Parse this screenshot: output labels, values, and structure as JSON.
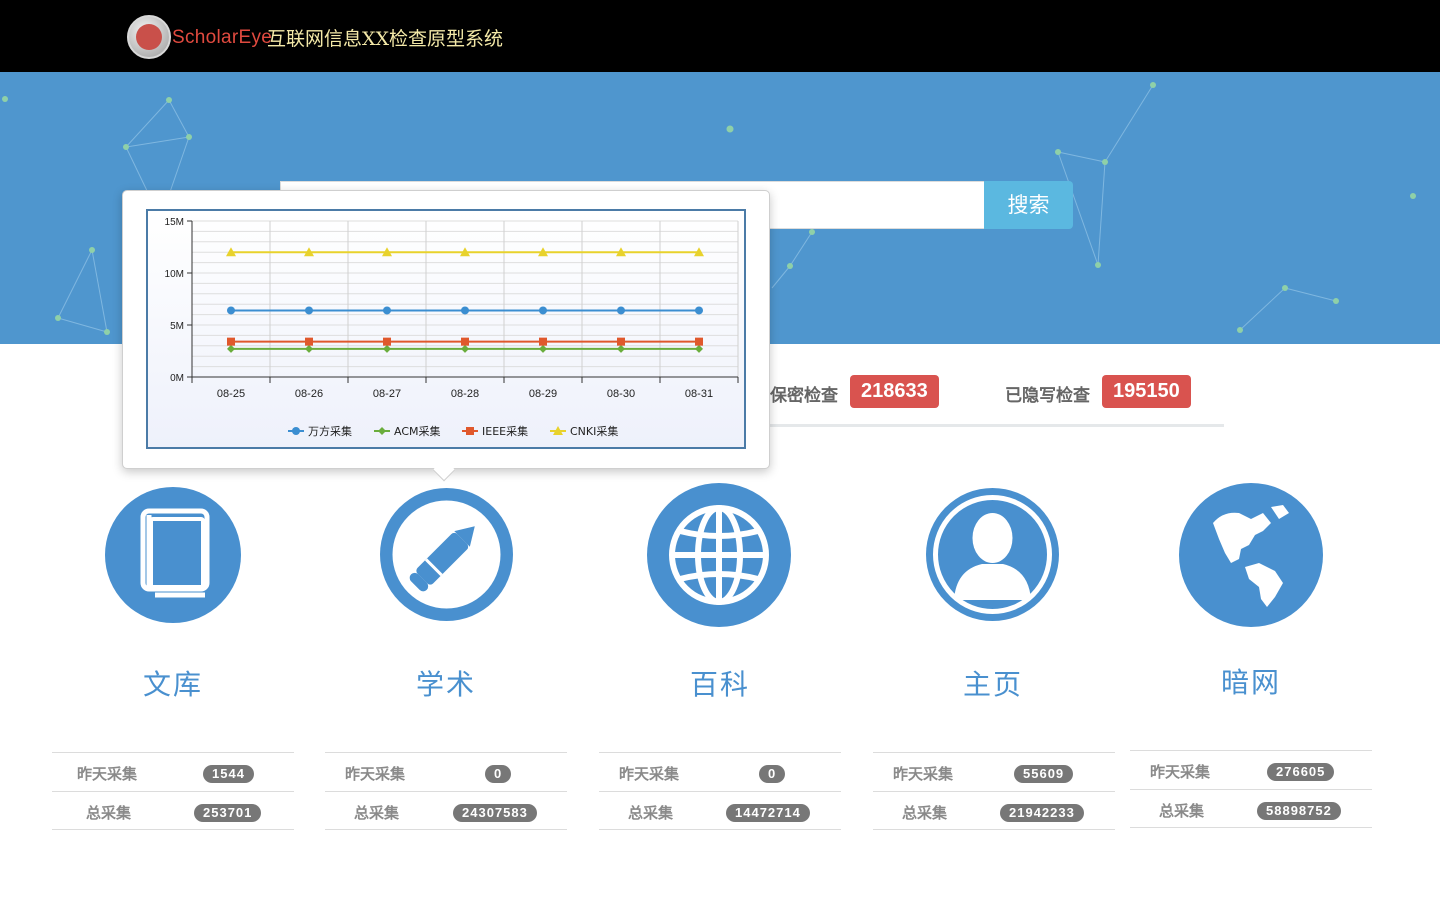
{
  "header": {
    "brand": "ScholarEye",
    "title": "互联网信息XX检查原型系统"
  },
  "search": {
    "placeholder": "",
    "value": "",
    "button": "搜索"
  },
  "stats": [
    {
      "label": "保密检查",
      "value": "218633"
    },
    {
      "label": "已隐写检查",
      "value": "195150"
    }
  ],
  "chart_data": {
    "type": "line",
    "x": [
      "08-25",
      "08-26",
      "08-27",
      "08-28",
      "08-29",
      "08-30",
      "08-31"
    ],
    "ylim": [
      0,
      15000000
    ],
    "yticks": [
      "0M",
      "5M",
      "10M",
      "15M"
    ],
    "ytick_values": [
      0,
      5000000,
      10000000,
      15000000
    ],
    "grid": true,
    "legend": "bottom",
    "series": [
      {
        "name": "万方采集",
        "color": "#3b8ed1",
        "marker": "circle",
        "values": [
          6400000,
          6400000,
          6400000,
          6400000,
          6400000,
          6400000,
          6400000
        ]
      },
      {
        "name": "ACM采集",
        "color": "#6aad3c",
        "marker": "diamond",
        "values": [
          2700000,
          2700000,
          2700000,
          2700000,
          2700000,
          2700000,
          2700000
        ]
      },
      {
        "name": "IEEE采集",
        "color": "#e0582c",
        "marker": "square",
        "values": [
          3400000,
          3400000,
          3400000,
          3400000,
          3400000,
          3400000,
          3400000
        ]
      },
      {
        "name": "CNKI采集",
        "color": "#e8d22c",
        "marker": "triangle",
        "values": [
          12000000,
          12000000,
          12000000,
          12000000,
          12000000,
          12000000,
          12000000
        ]
      }
    ]
  },
  "categories": [
    {
      "title": "文库",
      "icon": "book-icon",
      "yesterday_label": "昨天采集",
      "yesterday": "1544",
      "total_label": "总采集",
      "total": "253701"
    },
    {
      "title": "学术",
      "icon": "pencil-icon",
      "yesterday_label": "昨天采集",
      "yesterday": "0",
      "total_label": "总采集",
      "total": "24307583"
    },
    {
      "title": "百科",
      "icon": "globe-icon",
      "yesterday_label": "昨天采集",
      "yesterday": "0",
      "total_label": "总采集",
      "total": "14472714"
    },
    {
      "title": "主页",
      "icon": "user-icon",
      "yesterday_label": "昨天采集",
      "yesterday": "55609",
      "total_label": "总采集",
      "total": "21942233"
    },
    {
      "title": "暗网",
      "icon": "world-map-icon",
      "yesterday_label": "昨天采集",
      "yesterday": "276605",
      "total_label": "总采集",
      "total": "58898752"
    }
  ],
  "colors": {
    "topbar": "#000000",
    "hero": "#4f96ce",
    "accent": "#4990cf",
    "badge_red": "#d9534f",
    "badge_gray": "#777777",
    "search_button": "#5bb8e0"
  }
}
